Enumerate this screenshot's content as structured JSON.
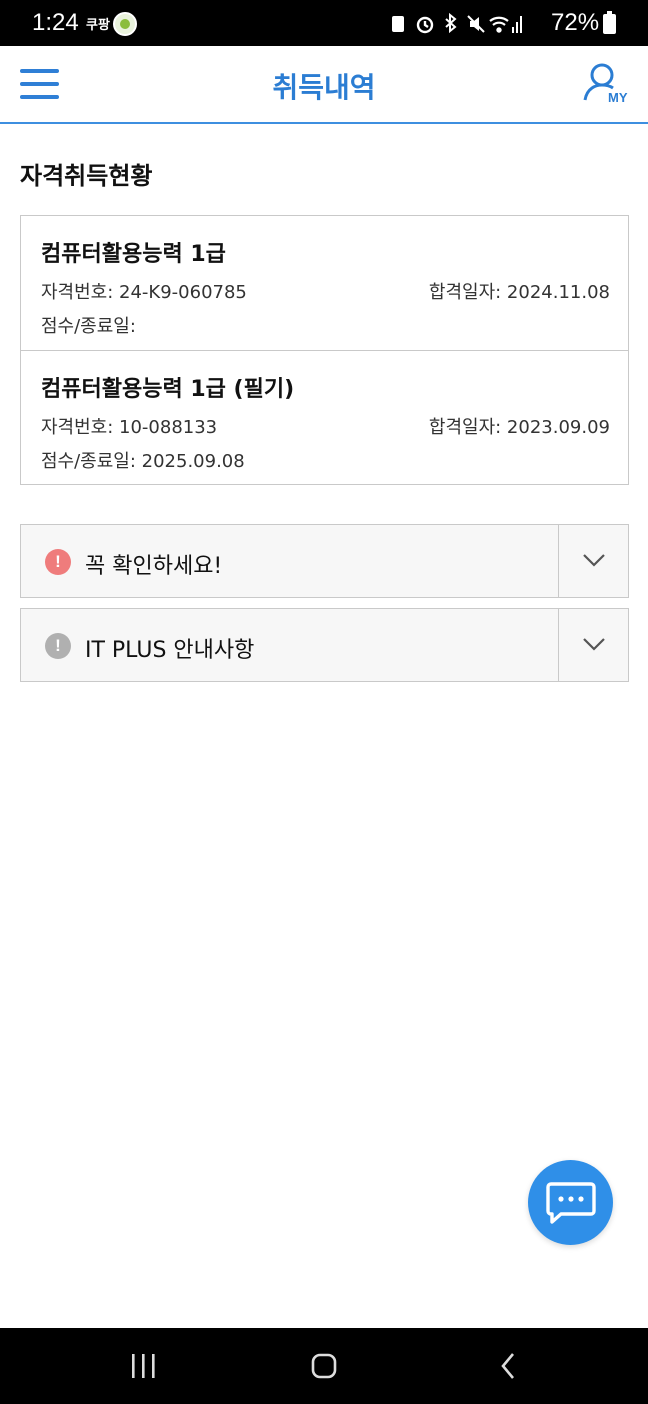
{
  "status_bar": {
    "time": "1:24",
    "app_text": "쿠팡",
    "battery": "72%",
    "icons": [
      "lock-icon",
      "alarm-icon",
      "bluetooth-icon",
      "mute-icon",
      "wifi-icon",
      "signal-icon",
      "battery-icon"
    ]
  },
  "header": {
    "title": "취득내역",
    "my_label": "MY"
  },
  "section": {
    "title": "자격취득현황"
  },
  "certificates": [
    {
      "name": "컴퓨터활용능력 1급",
      "number": "자격번호: 24-K9-060785",
      "pass_date": "합격일자: 2024.11.08",
      "score_end": "점수/종료일:"
    },
    {
      "name": "컴퓨터활용능력 1급 (필기)",
      "number": "자격번호: 10-088133",
      "pass_date": "합격일자: 2023.09.09",
      "score_end": "점수/종료일: 2025.09.08"
    }
  ],
  "notices": [
    {
      "text": "꼭 확인하세요!",
      "icon": "alert-icon",
      "color": "#ef7c7c"
    },
    {
      "text": "IT PLUS 안내사항",
      "icon": "alert-icon",
      "color": "#b0b0b0"
    }
  ],
  "colors": {
    "accent": "#2b7dd3",
    "chat_button": "#2f8fe8",
    "border": "#c9c9c9"
  }
}
